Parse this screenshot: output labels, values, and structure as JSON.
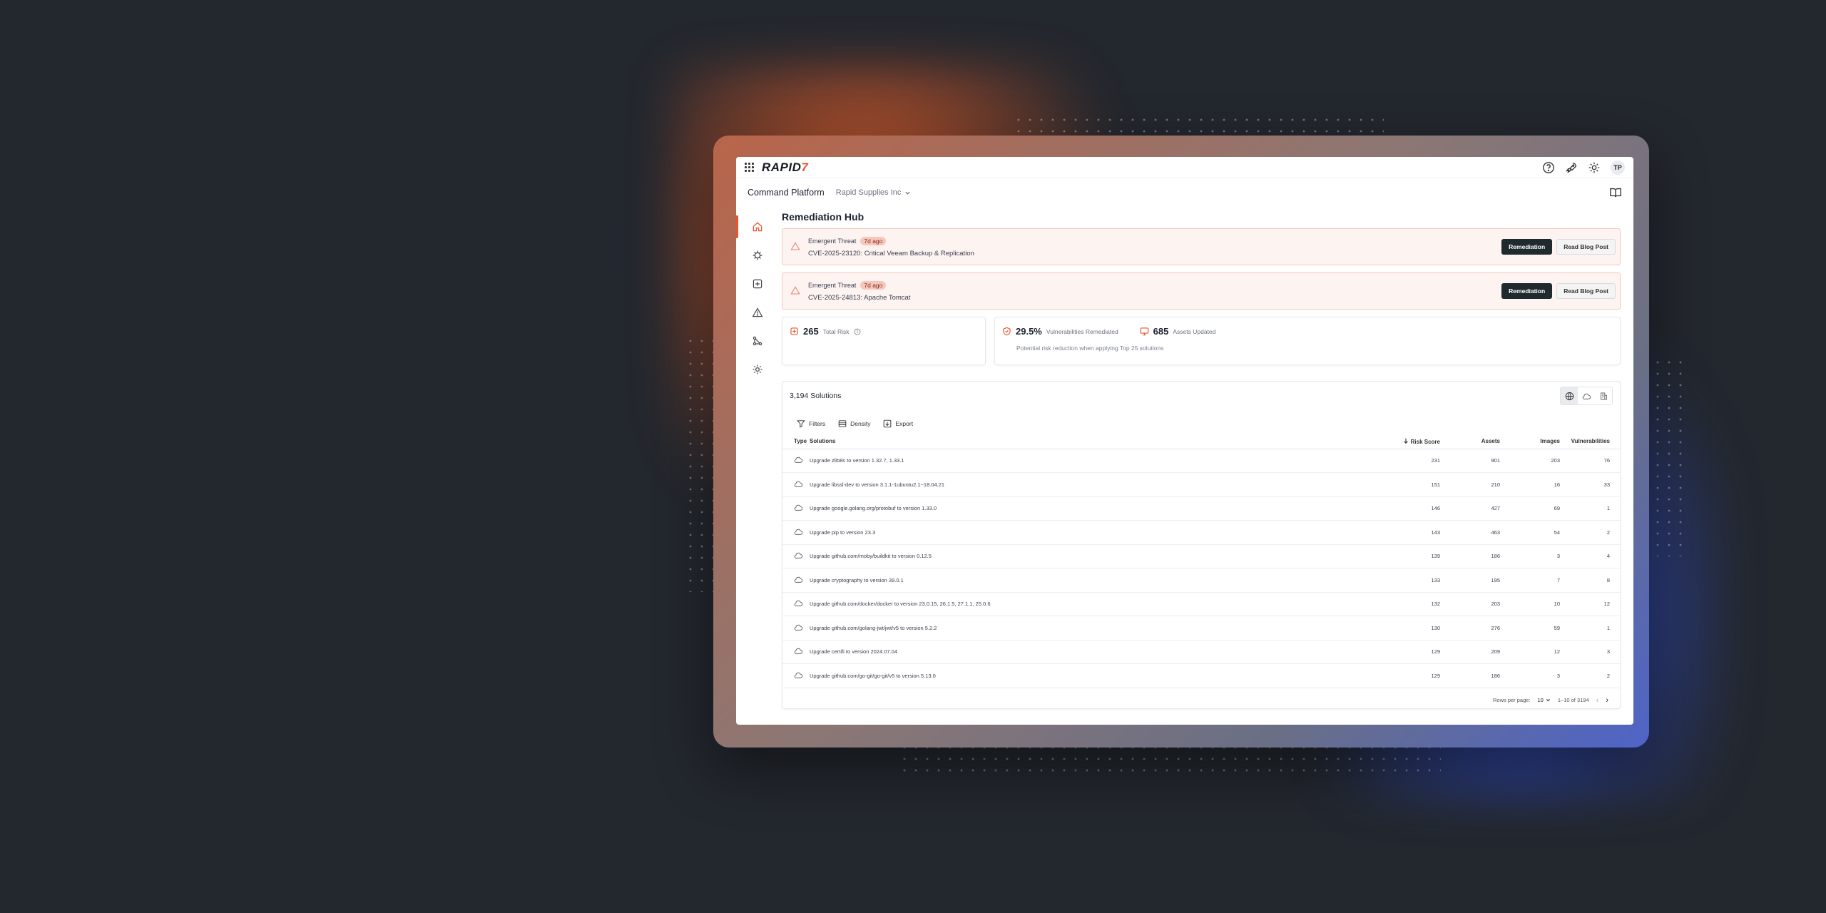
{
  "app": {
    "logo_text": "RAPID",
    "logo_mark": "7",
    "platform": "Command Platform",
    "org": "Rapid Supplies Inc",
    "avatar": "TP"
  },
  "page": {
    "title": "Remediation Hub"
  },
  "alerts": [
    {
      "label": "Emergent Threat",
      "age": "7d ago",
      "text": "CVE-2025-23120: Critical Veeam Backup & Replication",
      "primary": "Remediation",
      "secondary": "Read Blog Post"
    },
    {
      "label": "Emergent Threat",
      "age": "7d ago",
      "text": "CVE-2025-24813: Apache Tomcat",
      "primary": "Remediation",
      "secondary": "Read Blog Post"
    }
  ],
  "stats": {
    "total_risk": {
      "value": "265",
      "label": "Total Risk"
    },
    "remediated": {
      "value": "29.5%",
      "label": "Vulnerabilities Remediated"
    },
    "assets": {
      "value": "685",
      "label": "Assets Updated"
    },
    "note": "Potential risk reduction when applying Top 25 solutions"
  },
  "table": {
    "title": "3,194 Solutions",
    "toolbar": {
      "filters": "Filters",
      "density": "Density",
      "export": "Export"
    },
    "columns": {
      "type": "Type",
      "solutions": "Solutions",
      "risk": "Risk Score",
      "assets": "Assets",
      "images": "Images",
      "vulns": "Vulnerabilities"
    },
    "rows": [
      {
        "solution": "Upgrade zlib8s to version 1.32.7, 1.33.1",
        "risk": "231",
        "assets": "901",
        "images": "203",
        "vulns": "76"
      },
      {
        "solution": "Upgrade libssl-dev to version 3.1.1-1ubuntu2.1~18.04.21",
        "risk": "151",
        "assets": "210",
        "images": "16",
        "vulns": "33"
      },
      {
        "solution": "Upgrade google.golang.org/protobuf to version 1.33.0",
        "risk": "146",
        "assets": "427",
        "images": "69",
        "vulns": "1"
      },
      {
        "solution": "Upgrade pip to version 23.3",
        "risk": "143",
        "assets": "463",
        "images": "54",
        "vulns": "2"
      },
      {
        "solution": "Upgrade github.com/moby/buildkit to version 0.12.5",
        "risk": "139",
        "assets": "186",
        "images": "3",
        "vulns": "4"
      },
      {
        "solution": "Upgrade cryptography to version 39.0.1",
        "risk": "133",
        "assets": "195",
        "images": "7",
        "vulns": "8"
      },
      {
        "solution": "Upgrade github.com/docker/docker to version 23.0.15, 26.1.5, 27.1.1, 25.0.6",
        "risk": "132",
        "assets": "203",
        "images": "10",
        "vulns": "12"
      },
      {
        "solution": "Upgrade github.com/golang-jwt/jwt/v5 to version 5.2.2",
        "risk": "130",
        "assets": "276",
        "images": "59",
        "vulns": "1"
      },
      {
        "solution": "Upgrade certifi to version 2024.07.04",
        "risk": "129",
        "assets": "209",
        "images": "12",
        "vulns": "3"
      },
      {
        "solution": "Upgrade github.com/go-git/go-git/v5 to version 5.13.0",
        "risk": "129",
        "assets": "186",
        "images": "3",
        "vulns": "2"
      }
    ],
    "pager": {
      "rows_label": "Rows per page:",
      "rows_value": "10",
      "range": "1–10 of 3194"
    }
  },
  "colors": {
    "accent": "#e8542c",
    "dark_button": "#1f2a2e",
    "alert_bg": "#fdf3f1"
  }
}
